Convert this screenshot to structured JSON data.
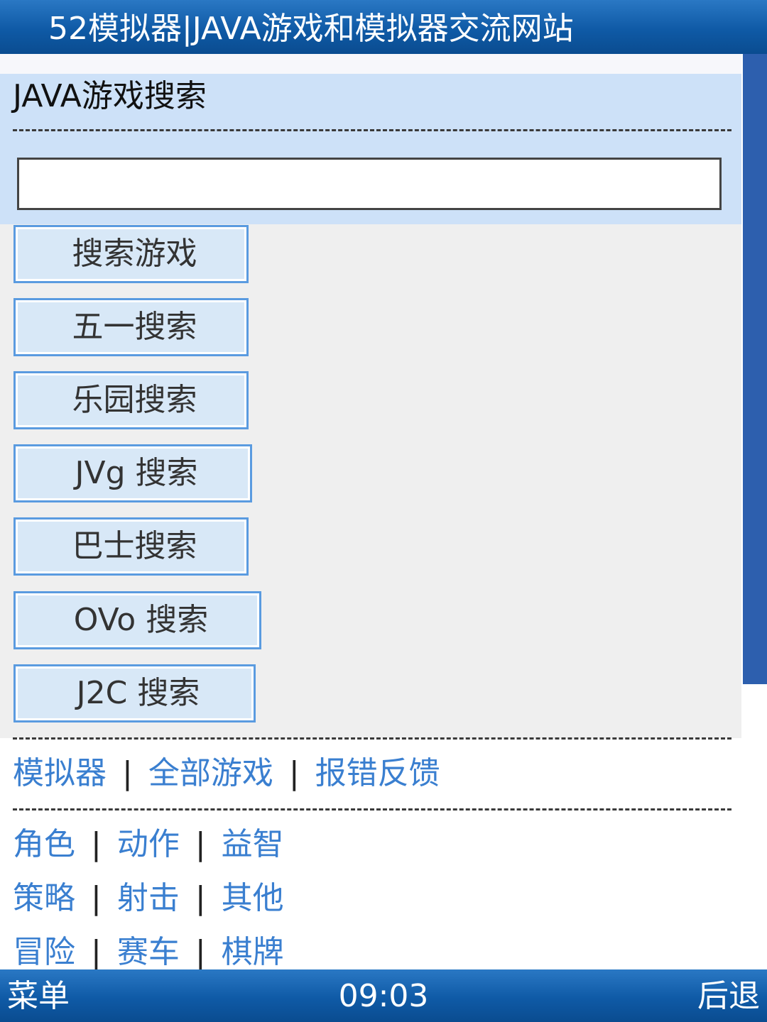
{
  "titlebar": {
    "title": "52模拟器|JAVA游戏和模拟器交流网站"
  },
  "search": {
    "heading": "JAVA游戏搜索",
    "input_value": ""
  },
  "engines": [
    {
      "label": "搜索游戏"
    },
    {
      "label": "五一搜索"
    },
    {
      "label": "乐园搜索"
    },
    {
      "label": "JVg 搜索"
    },
    {
      "label": "巴士搜索"
    },
    {
      "label": "OVo 搜索"
    },
    {
      "label": "J2C 搜索"
    }
  ],
  "nav_links": [
    {
      "label": "模拟器"
    },
    {
      "label": "全部游戏"
    },
    {
      "label": "报错反馈"
    }
  ],
  "separator": "|",
  "categories": [
    [
      "角色",
      "动作",
      "益智"
    ],
    [
      "策略",
      "射击",
      "其他"
    ],
    [
      "冒险",
      "赛车",
      "棋牌"
    ]
  ],
  "softkeys": {
    "left": "菜单",
    "clock": "09:03",
    "right": "后退"
  },
  "colors": {
    "bar_blue": "#0f5aa6",
    "panel_blue": "#cde1f8",
    "link_blue": "#3a7fd0",
    "scroll_thumb": "#2d5fae",
    "button_fill": "#d8e8f7"
  }
}
